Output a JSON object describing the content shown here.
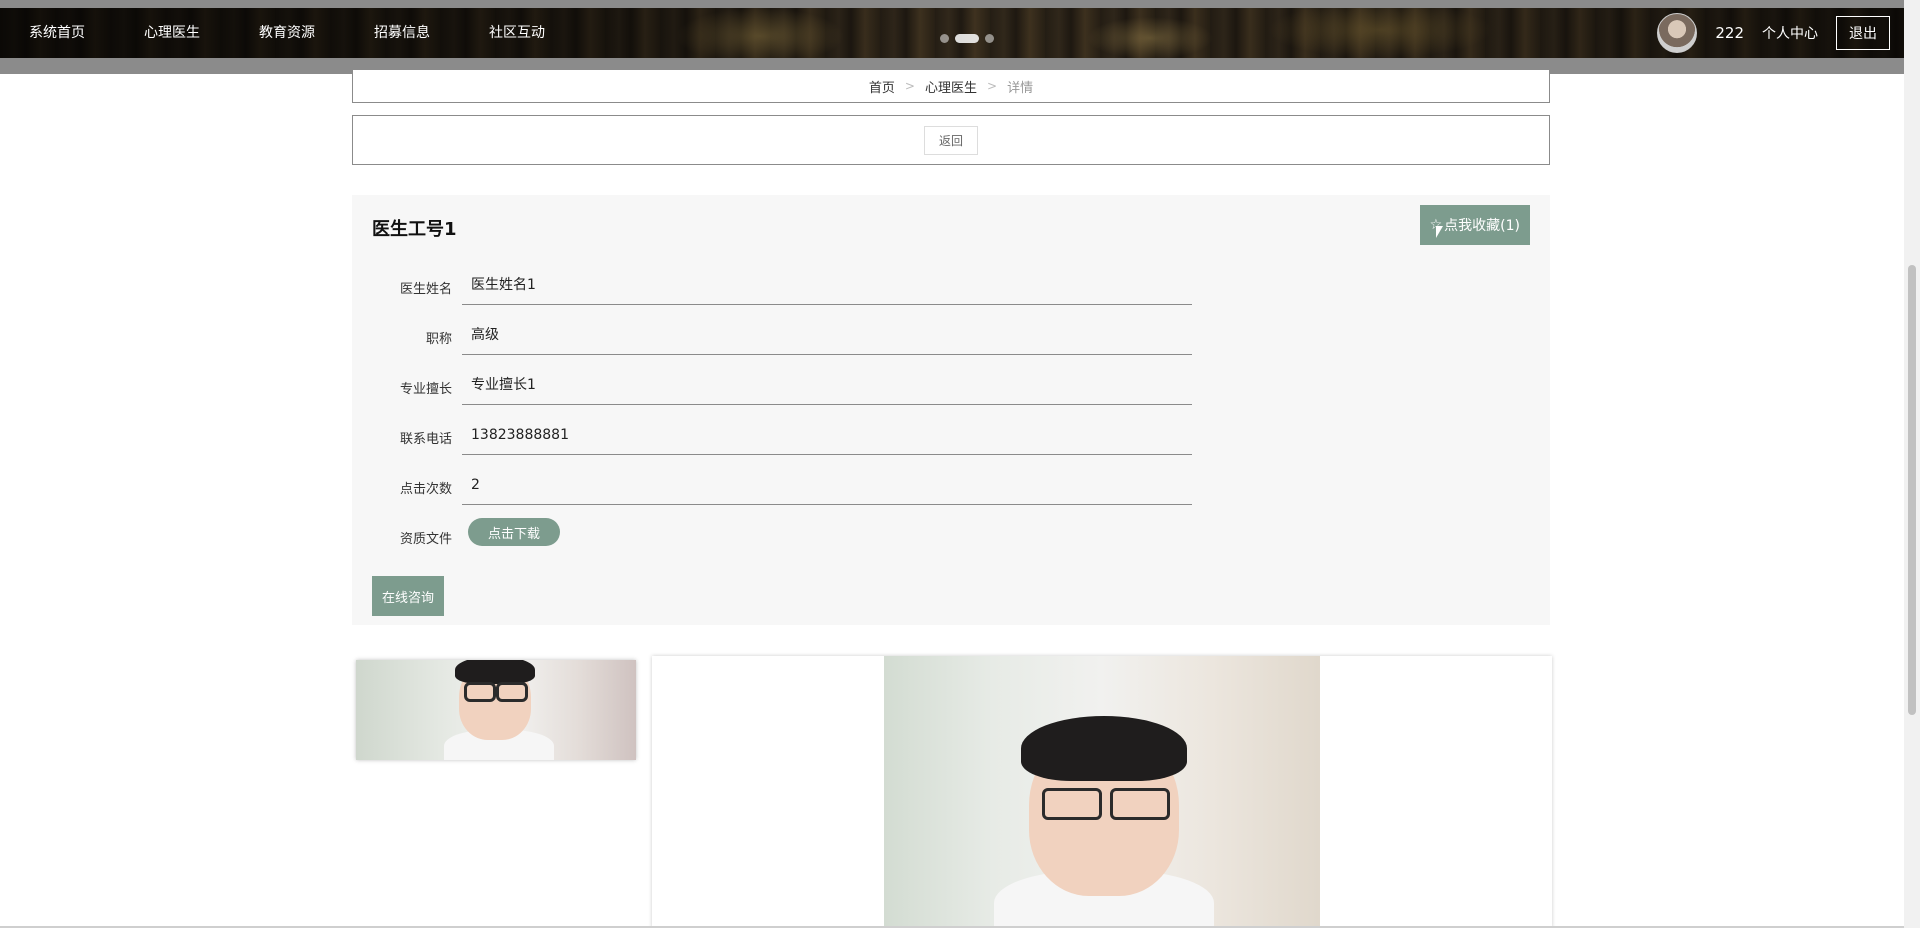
{
  "nav": {
    "items": [
      "系统首页",
      "心理医生",
      "教育资源",
      "招募信息",
      "社区互动"
    ],
    "username": "222",
    "center_label": "个人中心",
    "logout_label": "退出"
  },
  "breadcrumb": {
    "home": "首页",
    "section": "心理医生",
    "current": "详情",
    "separator": ">"
  },
  "back_label": "返回",
  "detail": {
    "title": "医生工号1",
    "fav_icon": "☆",
    "fav_label": "点我收藏(1)",
    "fields": [
      {
        "label": "医生姓名",
        "value": "医生姓名1"
      },
      {
        "label": "职称",
        "value": "高级"
      },
      {
        "label": "专业擅长",
        "value": "专业擅长1"
      },
      {
        "label": "联系电话",
        "value": "13823888881"
      },
      {
        "label": "点击次数",
        "value": "2"
      }
    ],
    "file_label": "资质文件",
    "download_label": "点击下载",
    "consult_label": "在线咨询"
  },
  "colors": {
    "accent": "#7d9c8e",
    "border": "#8b8b8b",
    "panel": "#f7f7f7"
  }
}
